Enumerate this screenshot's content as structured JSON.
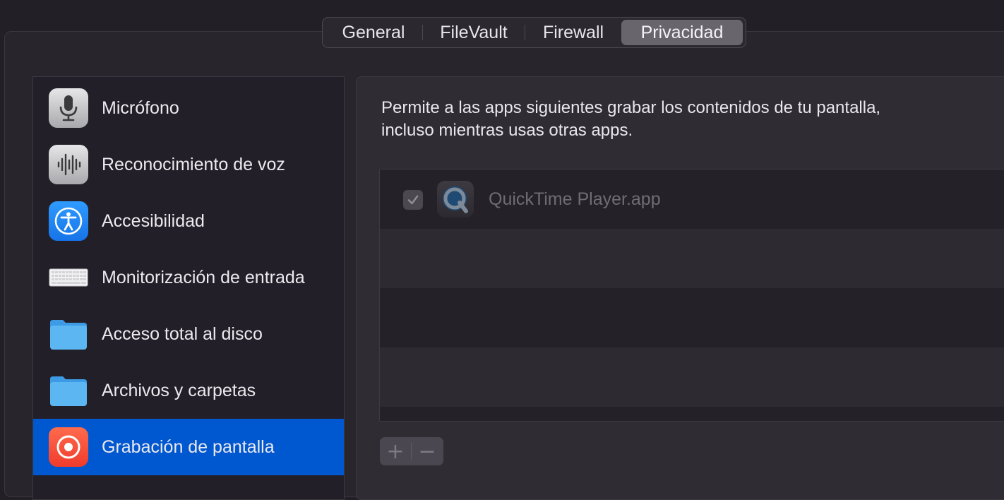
{
  "tabs": [
    {
      "label": "General",
      "selected": false
    },
    {
      "label": "FileVault",
      "selected": false
    },
    {
      "label": "Firewall",
      "selected": false
    },
    {
      "label": "Privacidad",
      "selected": true
    }
  ],
  "sidebar": {
    "items": [
      {
        "label": "Micrófono",
        "icon": "microphone-icon",
        "selected": false
      },
      {
        "label": "Reconocimiento de voz",
        "icon": "speech-waveform-icon",
        "selected": false
      },
      {
        "label": "Accesibilidad",
        "icon": "accessibility-icon",
        "selected": false
      },
      {
        "label": "Monitorización de entrada",
        "icon": "keyboard-icon",
        "selected": false
      },
      {
        "label": "Acceso total al disco",
        "icon": "folder-icon",
        "selected": false
      },
      {
        "label": "Archivos y carpetas",
        "icon": "folder-icon",
        "selected": false
      },
      {
        "label": "Grabación de pantalla",
        "icon": "screen-recording-icon",
        "selected": true
      }
    ]
  },
  "content": {
    "description_line1": "Permite a las apps siguientes grabar los contenidos de tu pantalla,",
    "description_line2": "incluso mientras usas otras apps.",
    "apps": [
      {
        "name": "QuickTime Player.app",
        "checked": true,
        "icon": "quicktime-icon",
        "enabled": false
      }
    ],
    "add_label": "+",
    "remove_label": "−"
  },
  "colors": {
    "selection_blue": "#0058d0",
    "background": "#221f27",
    "panel": "#2f2c34"
  }
}
